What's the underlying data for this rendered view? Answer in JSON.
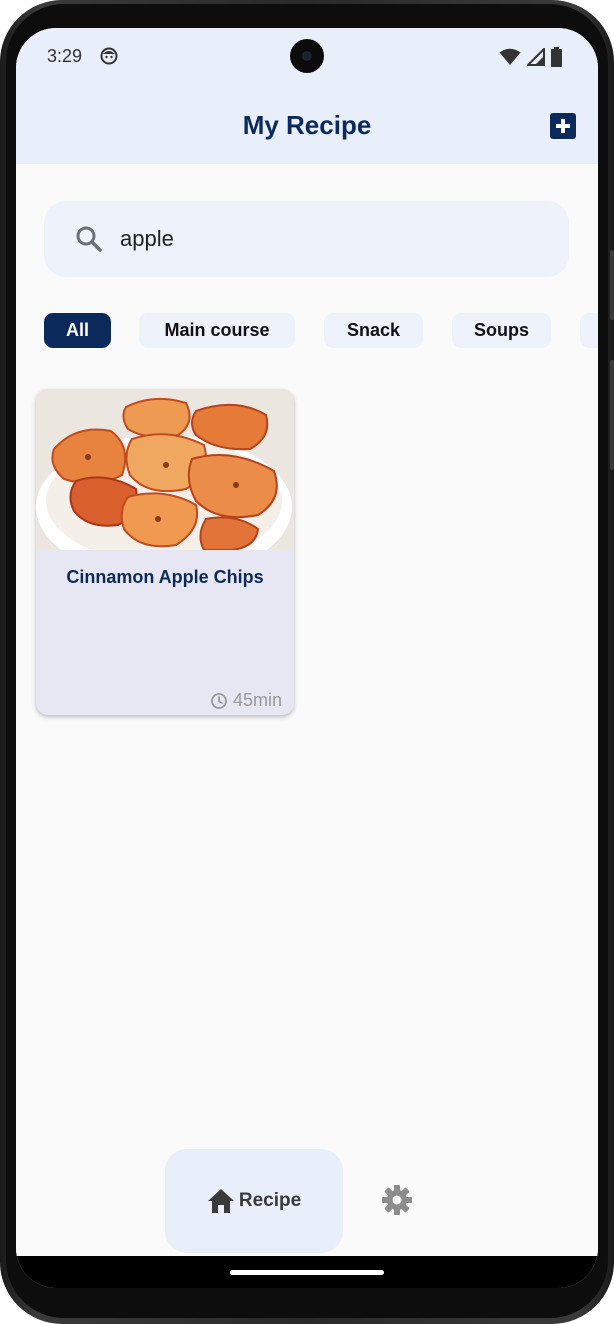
{
  "status_bar": {
    "time": "3:29",
    "icons": [
      "face-icon",
      "wifi-icon",
      "signal-icon",
      "battery-icon"
    ]
  },
  "header": {
    "title": "My Recipe",
    "add_icon": "add-box-icon"
  },
  "search": {
    "value": "apple",
    "icon": "search-icon"
  },
  "categories": {
    "items": [
      {
        "label": "All",
        "active": true
      },
      {
        "label": "Main course",
        "active": false
      },
      {
        "label": "Snack",
        "active": false
      },
      {
        "label": "Soups",
        "active": false
      }
    ]
  },
  "results": {
    "items": [
      {
        "title": "Cinnamon Apple Chips",
        "time": "45min",
        "image": "apple-chips-photo"
      }
    ]
  },
  "bottom_nav": {
    "recipe_label": "Recipe",
    "recipe_icon": "home-icon",
    "settings_icon": "gear-icon"
  },
  "colors": {
    "primary": "#0b2a5b",
    "header_bg": "#e9eefb",
    "chip_bg": "#eef2fb",
    "card_bg": "#e7e7f3",
    "muted_text": "#9a9a9a"
  }
}
